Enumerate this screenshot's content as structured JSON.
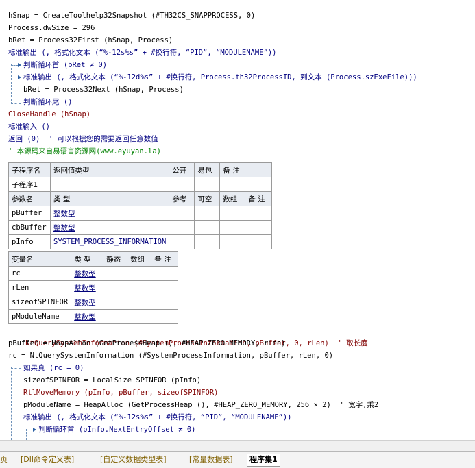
{
  "code_lines_top": [
    "hSnap = CreateToolhelp32Snapshot (#TH32CS_SNAPPROCESS, 0)",
    "Process.dwSize = 296",
    "bRet = Process32First (hSnap, Process)",
    "标准输出 (, 格式化文本 (“%-12s%s” + #换行符, “PID”, “MODULENAME”))",
    "判断循环首 (bRet ≠ 0)",
    "标准输出 (, 格式化文本 (“%-12d%s” + #换行符, Process.th32ProcessID, 到文本 (Process.szExeFile)))",
    "bRet = Process32Next (hSnap, Process)",
    "判断循环尾 ()",
    "CloseHandle (hSnap)",
    "标准输入 ()",
    "返回 (0)  ' 可以根据您的需要返回任意数值",
    "' 本源码来自易语言资源网(www.eyuyan.la)"
  ],
  "sub_table": {
    "headers": [
      "子程序名",
      "返回值类型",
      "公开",
      "易包",
      "备 注"
    ],
    "row": [
      "子程序1",
      "",
      "",
      "",
      ""
    ],
    "param_headers": [
      "参数名",
      "类 型",
      "参考",
      "可空",
      "数组",
      "备 注"
    ],
    "params": [
      {
        "name": "pBuffer",
        "type": "整数型"
      },
      {
        "name": "cbBuffer",
        "type": "整数型"
      },
      {
        "name": "pInfo",
        "type": "SYSTEM_PROCESS_INFORMATION"
      }
    ]
  },
  "var_table": {
    "headers": [
      "变量名",
      "类 型",
      "静态",
      "数组",
      "备 注"
    ],
    "vars": [
      {
        "name": "rc",
        "type": "整数型"
      },
      {
        "name": "rLen",
        "type": "整数型"
      },
      {
        "name": "sizeofSPINFOR",
        "type": "整数型"
      },
      {
        "name": "pModuleName",
        "type": "整数型"
      }
    ]
  },
  "code_lines_bottom": [
    "NtQuerySystemInformation (#SystemProcessInformation, pBuffer, 0, rLen)  ' 取长度",
    "pBuffer = HeapAlloc (GetProcessHeap (), #HEAP_ZERO_MEMORY, rLen)",
    "rc = NtQuerySystemInformation (#SystemProcessInformation, pBuffer, rLen, 0)",
    "如果真 (rc = 0)",
    "sizeofSPINFOR = LocalSize_SPINFOR (pInfo)",
    "RtlMoveMemory (pInfo, pBuffer, sizeofSPINFOR)",
    "pModuleName = HeapAlloc (GetProcessHeap (), #HEAP_ZERO_MEMORY, 256 × 2)  ' 宽字,乘2",
    "标准输出 (, 格式化文本 (“%-12s%s” + #换行符, “PID”, “MODULENAME”))",
    "判断循环首 (pInfo.NextEntryOffset ≠ 0)"
  ],
  "tabs": [
    "页",
    "[Dll命令定义表]",
    "[自定义数据类型表]",
    "[常量数据表]",
    "程序集1"
  ],
  "colors": {
    "keyword": "#000080",
    "function": "#800000",
    "comment": "#008000",
    "type_link": "#00007a"
  }
}
